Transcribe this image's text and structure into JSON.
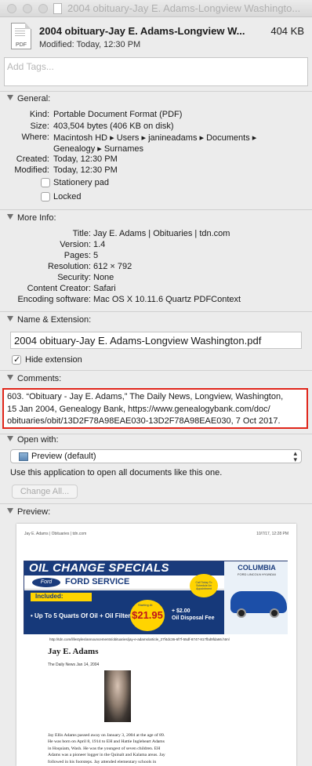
{
  "window": {
    "title": "2004 obituary-Jay E. Adams-Longview Washingto..."
  },
  "header": {
    "filename": "2004 obituary-Jay E. Adams-Longview W...",
    "size": "404 KB",
    "modified": "Modified: Today, 12:30 PM",
    "icon_label": "PDF"
  },
  "tags": {
    "placeholder": "Add Tags..."
  },
  "general": {
    "heading": "General:",
    "kind_label": "Kind:",
    "kind": "Portable Document Format (PDF)",
    "size_label": "Size:",
    "size": "403,504 bytes (406 KB on disk)",
    "where_label": "Where:",
    "where_line1": "Macintosh HD ▸ Users ▸ janineadams ▸ Documents ▸",
    "where_line2": "Genealogy ▸ Surnames",
    "created_label": "Created:",
    "created": "Today, 12:30 PM",
    "modified_label": "Modified:",
    "modified": "Today, 12:30 PM",
    "stationery_label": "Stationery pad",
    "locked_label": "Locked"
  },
  "more_info": {
    "heading": "More Info:",
    "title_label": "Title:",
    "title": "Jay E. Adams | Obituaries | tdn.com",
    "version_label": "Version:",
    "version": "1.4",
    "pages_label": "Pages:",
    "pages": "5",
    "resolution_label": "Resolution:",
    "resolution": "612 × 792",
    "security_label": "Security:",
    "security": "None",
    "creator_label": "Content Creator:",
    "creator": "Safari",
    "encoding_label": "Encoding software:",
    "encoding": "Mac OS X 10.11.6 Quartz PDFContext"
  },
  "name_extension": {
    "heading": "Name & Extension:",
    "value": "2004 obituary-Jay E. Adams-Longview Washington.pdf",
    "hide_extension_label": "Hide extension"
  },
  "comments": {
    "heading": "Comments:",
    "line1": "603. “Obituary - Jay E. Adams,” The Daily News, Longview, Washington,",
    "line2": "15 Jan 2004, Genealogy Bank, https://www.genealogybank.com/doc/",
    "line3": "obituaries/obit/13D2F78A98EAE030-13D2F78A98EAE030, 7 Oct 2017."
  },
  "open_with": {
    "heading": "Open with:",
    "selected": "Preview (default)",
    "description": "Use this application to open all documents like this one.",
    "change_all": "Change All..."
  },
  "preview": {
    "heading": "Preview:",
    "page_header_left": "Jay E. Adams | Obituaries | tdn.com",
    "page_header_right": "10/7/17, 12:28 PM",
    "ad_title": "OIL CHANGE SPECIALS",
    "ad_ford": "Ford",
    "ad_service": "FORD SERVICE",
    "ad_included": "Included:",
    "ad_item": "• Up To 5 Quarts Of Oil + Oil Filter",
    "ad_starting": "Starting At",
    "ad_price": "$21.95",
    "ad_fee_line1": "+ $2.00",
    "ad_fee_line2": "Oil Disposal Fee",
    "ad_dealer": "COLUMBIA",
    "ad_dealer_sub": "FORD LINCOLN HYUNDAI",
    "ad_cta": "Call Today To Schedule An Appointment",
    "url": "http://tdn.com/lifestyles/announcements/obituaries/jay-e-adams/article_27f4dc36-6f7f-55df-8747-817fbd9fda66.html",
    "name": "Jay E. Adams",
    "source": "The Daily News   Jan 14, 2004",
    "text_line1": "Jay Ellis Adams passed away on January 3, 2004 at the age of 89.",
    "text_line2": "He was born on April 8, 1914 to EH and Hattie Ingleheart Adams",
    "text_line3": "in Hoquiam, Wash. He was the youngest of seven children. EH",
    "text_line4": "Adams was a pioneer logger in the Quinalt and Kalama areas. Jay",
    "text_line5": "followed in his footsteps. Jay attended elementary schools in"
  }
}
